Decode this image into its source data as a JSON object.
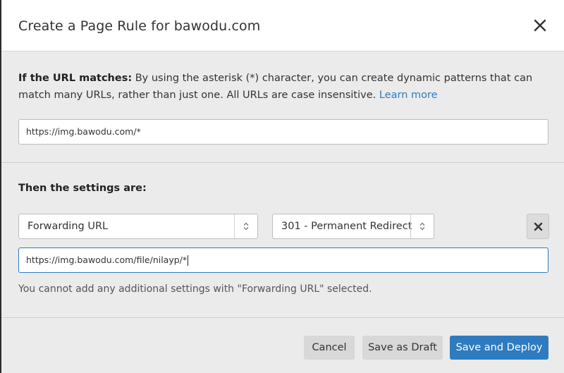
{
  "dialog": {
    "title": "Create a Page Rule for bawodu.com"
  },
  "url_section": {
    "heading": "If the URL matches:",
    "description": " By using the asterisk (*) character, you can create dynamic patterns that can match many URLs, rather than just one. All URLs are case insensitive. ",
    "learn_more": "Learn more",
    "url_value": "https://img.bawodu.com/*"
  },
  "settings_section": {
    "heading": "Then the settings are:",
    "setting_select": "Forwarding URL",
    "status_select": "301 - Permanent Redirect",
    "destination_value": "https://img.bawodu.com/file/nilayp/*",
    "note": "You cannot add any additional settings with \"Forwarding URL\" selected."
  },
  "footer": {
    "cancel_label": "Cancel",
    "draft_label": "Save as Draft",
    "deploy_label": "Save and Deploy"
  },
  "icons": {
    "close": "close-icon",
    "select_arrows": "sort-arrows-icon",
    "remove": "close-icon"
  },
  "colors": {
    "accent": "#2f7bbf",
    "background": "#ebebeb",
    "header": "#ffffff"
  }
}
